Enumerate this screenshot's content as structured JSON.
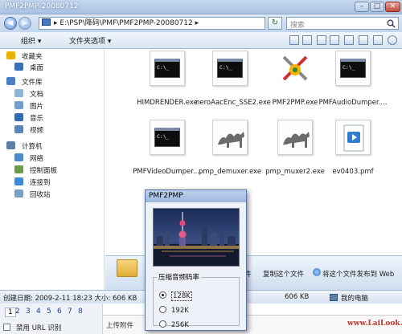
{
  "window": {
    "title": "PMF2PMP-20080712"
  },
  "address": {
    "path": "▸ E:\\PSP\\降码\\PMF\\PMF2PMP-20080712 ▸",
    "search_placeholder": "搜索"
  },
  "toolbar": {
    "organize": "组织 ▾",
    "sharing": "文件夹选项 ▾"
  },
  "sidebar": {
    "items": [
      {
        "label": "收藏夹",
        "icon": "star-icon",
        "color": "#e8b400"
      },
      {
        "label": "桌面",
        "icon": "desktop-icon",
        "color": "#3a6fb5"
      },
      {
        "label": "文件库",
        "icon": "library-icon",
        "color": "#4a7fc1"
      },
      {
        "label": "文档",
        "icon": "document-icon",
        "color": "#8fb3da"
      },
      {
        "label": "图片",
        "icon": "picture-icon",
        "color": "#6ea1cf"
      },
      {
        "label": "音乐",
        "icon": "music-icon",
        "color": "#2f6bb0"
      },
      {
        "label": "视频",
        "icon": "video-icon",
        "color": "#5b86b8"
      },
      {
        "label": "计算机",
        "icon": "computer-icon",
        "color": "#5d7fa8"
      },
      {
        "label": "网络",
        "icon": "network-icon",
        "color": "#4c8bc8"
      },
      {
        "label": "控制面板",
        "icon": "control-panel-icon",
        "color": "#6a9a4b"
      },
      {
        "label": "连接到",
        "icon": "connect-icon",
        "color": "#3d8ad6"
      },
      {
        "label": "回收站",
        "icon": "recycle-bin-icon",
        "color": "#7aa0c6"
      }
    ]
  },
  "files": [
    {
      "name": "HIMDRENDER.exe",
      "icon": "console-exe-icon"
    },
    {
      "name": "neroAacEnc_SSE2.exe",
      "icon": "console-exe-icon"
    },
    {
      "name": "PMF2PMP.exe",
      "icon": "tools-exe-icon"
    },
    {
      "name": "PMFAudioDumper....",
      "icon": "console-exe-icon"
    },
    {
      "name": "PMFVideoDumper....",
      "icon": "console-exe-icon"
    },
    {
      "name": "pmp_demuxer.exe",
      "icon": "camel-exe-icon"
    },
    {
      "name": "pmp_muxer2.exe",
      "icon": "camel-exe-icon"
    },
    {
      "name": "ev0403.pmf",
      "icon": "media-file-icon"
    }
  ],
  "details": {
    "a": "件",
    "b": "复制这个文件",
    "c": "将这个文件发布到 Web"
  },
  "status": {
    "created": "创建日期: 2009-2-11 18:23 大小: 606 KB",
    "size": "606 KB",
    "location": "我的电脑"
  },
  "pager": {
    "pages": [
      "1",
      "2",
      "3",
      "4",
      "5",
      "6",
      "7",
      "8"
    ],
    "disable_label": "禁用 URL 识别"
  },
  "upload": {
    "label": "上传附件"
  },
  "watermark": "www.LaiLook.com",
  "dialog": {
    "title": "PMF2PMP",
    "group_label": "压缩音频码率",
    "options": [
      "128K",
      "192K",
      "256K"
    ],
    "selected": "128K"
  }
}
